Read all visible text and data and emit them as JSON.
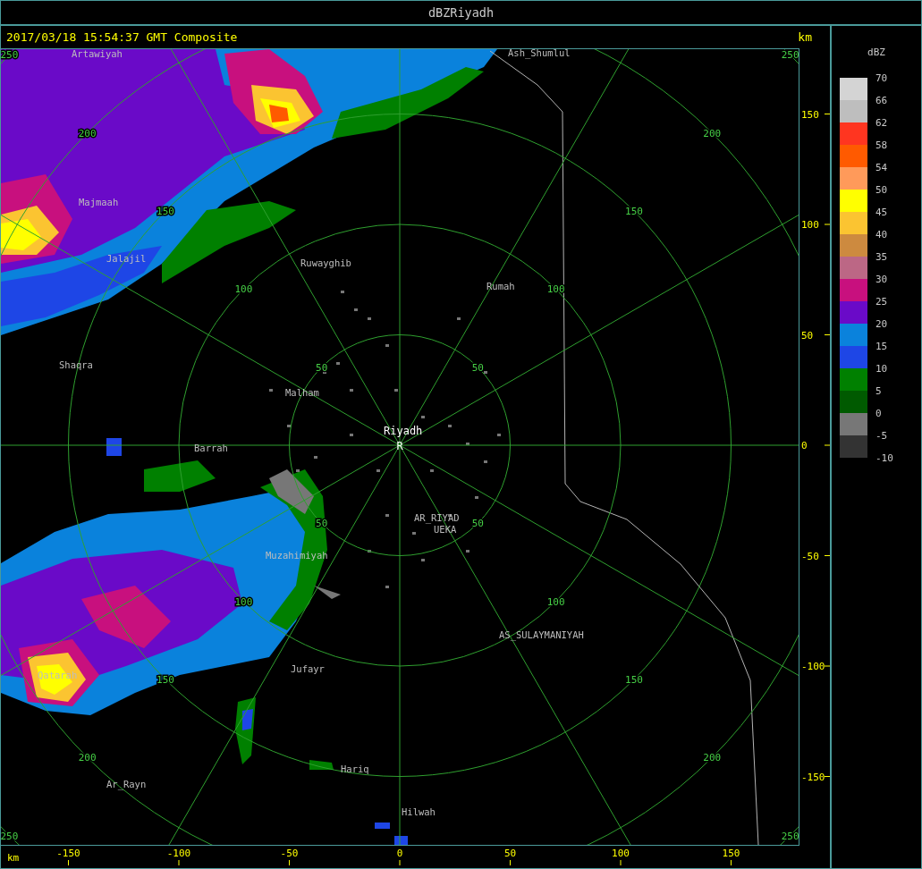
{
  "window": {
    "title": "dBZRiyadh"
  },
  "header": {
    "timestamp": "2017/03/18 15:54:37 GMT Composite",
    "unit": "km"
  },
  "map": {
    "range_rings": [
      {
        "labels": [
          "50",
          "50",
          "50",
          "50"
        ]
      },
      {
        "labels": [
          "100",
          "100",
          "100",
          "100"
        ]
      },
      {
        "labels": [
          "150",
          "150",
          "150",
          "150"
        ]
      },
      {
        "labels": [
          "200",
          "200",
          "200",
          "200"
        ]
      },
      {
        "labels": [
          "250",
          "250",
          "250",
          "250"
        ]
      }
    ],
    "places": [
      {
        "name": "Artawiyah",
        "kind": "town"
      },
      {
        "name": "Ash_Shumlul",
        "kind": "town"
      },
      {
        "name": "Majmaah",
        "kind": "town"
      },
      {
        "name": "Jalajil",
        "kind": "town"
      },
      {
        "name": "Ruwayghib",
        "kind": "town"
      },
      {
        "name": "Rumah",
        "kind": "town"
      },
      {
        "name": "Shaqra",
        "kind": "town"
      },
      {
        "name": "Malham",
        "kind": "town"
      },
      {
        "name": "Riyadh",
        "kind": "site"
      },
      {
        "name": "Barrah",
        "kind": "town"
      },
      {
        "name": "AR_RIYAD",
        "kind": "town"
      },
      {
        "name": "UEKA",
        "kind": "town"
      },
      {
        "name": "Muzahimiyah",
        "kind": "town"
      },
      {
        "name": "AS_SULAYMANIYAH",
        "kind": "town"
      },
      {
        "name": "Jufayr",
        "kind": "town"
      },
      {
        "name": "Qatarah",
        "kind": "town"
      },
      {
        "name": "Hariq",
        "kind": "town"
      },
      {
        "name": "Ar_Rayn",
        "kind": "town"
      },
      {
        "name": "Hilwah",
        "kind": "town"
      }
    ],
    "site_marker": "R"
  },
  "y_axis": {
    "ticks": [
      "150",
      "100",
      "50",
      "0",
      "-50",
      "-100",
      "-150"
    ]
  },
  "x_axis": {
    "unit": "km",
    "ticks": [
      "-150",
      "-100",
      "-50",
      "0",
      "50",
      "100",
      "150"
    ]
  },
  "legend": {
    "title": "dBZ",
    "labels": [
      "70",
      "66",
      "62",
      "58",
      "54",
      "50",
      "45",
      "40",
      "35",
      "30",
      "25",
      "20",
      "15",
      "10",
      "5",
      "0",
      "-5",
      "-10"
    ],
    "bins": [
      {
        "color": "#d4d4d4"
      },
      {
        "color": "#bebebe"
      },
      {
        "color": "#ff3520"
      },
      {
        "color": "#ff5a00"
      },
      {
        "color": "#ff9a5a"
      },
      {
        "color": "#ffff00"
      },
      {
        "color": "#fbc431"
      },
      {
        "color": "#cd8a3f"
      },
      {
        "color": "#bc6785"
      },
      {
        "color": "#c8107e"
      },
      {
        "color": "#6a0ac8"
      },
      {
        "color": "#0a82dc"
      },
      {
        "color": "#1e46e6"
      },
      {
        "color": "#008000"
      },
      {
        "color": "#005a00"
      },
      {
        "color": "#777777"
      },
      {
        "color": "#333333"
      }
    ]
  }
}
